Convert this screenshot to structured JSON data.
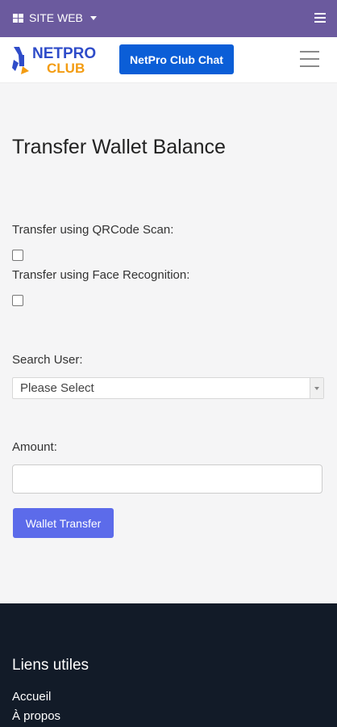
{
  "topbar": {
    "site_label": "SITE WEB"
  },
  "navbar": {
    "logo_top": "NETPRO",
    "logo_bottom": "CLUB",
    "chat_button": "NetPro Club Chat"
  },
  "main": {
    "title": "Transfer Wallet Balance",
    "qrcode_label": "Transfer using QRCode Scan:",
    "qrcode_checked": false,
    "face_label": "Transfer using Face Recognition:",
    "face_checked": false,
    "search_label": "Search User:",
    "search_selected": "Please Select",
    "amount_label": "Amount:",
    "amount_value": "",
    "submit_label": "Wallet Transfer"
  },
  "footer": {
    "heading": "Liens utiles",
    "links": [
      "Accueil",
      "À propos"
    ]
  },
  "colors": {
    "topbar": "#6b5a9e",
    "chat_button": "#0b5ed7",
    "submit_button": "#5c6bea",
    "footer": "#121b28",
    "logo_blue": "#2f4cc9",
    "logo_orange": "#f39c12"
  }
}
